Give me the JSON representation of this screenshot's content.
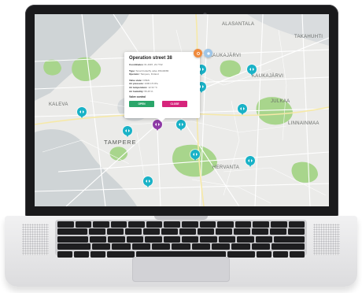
{
  "map": {
    "city_label": "TAMPERE",
    "district_labels": [
      "KAUKAJÄRVI",
      "ALASANTALA",
      "HERVANTA",
      "KAUKAJÄRVI",
      "JULKAA",
      "LINNAINMAA",
      "KALEVA",
      "TAKAHUHTI"
    ],
    "pin_icon": "sensor-arrows-icon",
    "colors": {
      "pin": "#19b2c7",
      "pin_active": "#8e3aa6",
      "park": "#a8d58c",
      "water": "#cfd4d6"
    }
  },
  "popup": {
    "title": "Operation street 38",
    "coordinates_label": "Coordinates:",
    "coordinates_value": "61.4997, 23.7742",
    "type_label": "Type:",
    "type_value": "Smart butterfly valve DN100/80",
    "operator_label": "Operator:",
    "operator_value": "Tampere, Finland",
    "valve_state_label": "Valve state:",
    "valve_state_value": "OPEN",
    "air_pressure_label": "Air pressure:",
    "air_pressure_value": "1006.15 hPa",
    "air_temp_label": "Air temperature:",
    "air_temp_value": "12.34 °C",
    "air_humidity_label": "Air humidity:",
    "air_humidity_value": "55.25 %",
    "section_title": "Valve control",
    "open_label": "OPEN",
    "close_label": "CLOSE",
    "header_icons": [
      "settings-icon",
      "info-icon"
    ]
  }
}
